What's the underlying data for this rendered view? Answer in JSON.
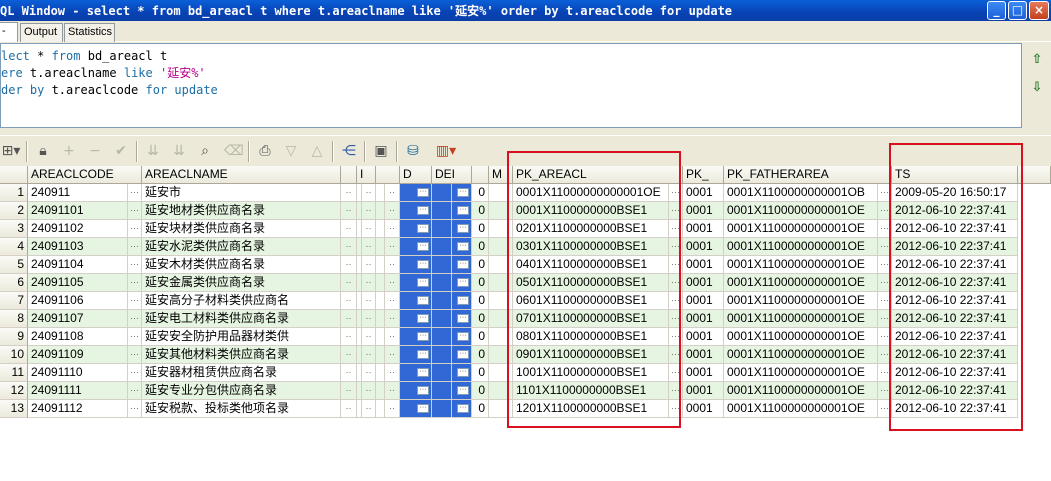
{
  "window": {
    "title": "SQL Window - select * from bd_areacl t where t.areaclname like '延安%' order by t.areaclcode for update",
    "title_visible": "QL Window - select * from bd_areacl t where t.areaclname like '延安%' order by t.areaclcode for update",
    "minimize": "_",
    "maximize": "□",
    "close": "×"
  },
  "tabs": [
    {
      "label": "-"
    },
    {
      "label": "Output"
    },
    {
      "label": "Statistics"
    }
  ],
  "editor": {
    "line1_kw1": "lect",
    "line1_kw2": "from",
    "line1_rest": " * ",
    "line1_table": " bd_areacl t",
    "line2_kw": "ere",
    "line2_mid": " t.areaclname ",
    "line2_kw2": "like",
    "line2_str": "'延安%'",
    "line3_kw": "der by",
    "line3_mid": " t.areaclcode ",
    "line3_kw2": "for update"
  },
  "grid": {
    "columns": [
      "",
      "AREACLCODE",
      "AREACLNAME",
      "",
      "I",
      "",
      "D",
      "DEI",
      "",
      "M",
      "PK_AREACL",
      "PK_",
      "PK_FATHERAREA",
      "TS"
    ],
    "rows": [
      {
        "n": "1",
        "code": "240911",
        "name": "延安市",
        "m": "0",
        "pk": "0001X11000000000001OE",
        "pkf": "0001X1100000000001OB",
        "ts": "2009-05-20 16:50:17",
        "pk_short": "0001"
      },
      {
        "n": "2",
        "code": "24091101",
        "name": "延安地材类供应商名录",
        "m": "0",
        "pk": "0001X1100000000BSE1",
        "pkf": "0001X1100000000001OE",
        "ts": "2012-06-10 22:37:41",
        "pk_short": "0001"
      },
      {
        "n": "3",
        "code": "24091102",
        "name": "延安块材类供应商名录",
        "m": "0",
        "pk": "0201X1100000000BSE1",
        "pkf": "0001X1100000000001OE",
        "ts": "2012-06-10 22:37:41",
        "pk_short": "0001"
      },
      {
        "n": "4",
        "code": "24091103",
        "name": "延安水泥类供应商名录",
        "m": "0",
        "pk": "0301X1100000000BSE1",
        "pkf": "0001X1100000000001OE",
        "ts": "2012-06-10 22:37:41",
        "pk_short": "0001"
      },
      {
        "n": "5",
        "code": "24091104",
        "name": "延安木材类供应商名录",
        "m": "0",
        "pk": "0401X1100000000BSE1",
        "pkf": "0001X1100000000001OE",
        "ts": "2012-06-10 22:37:41",
        "pk_short": "0001"
      },
      {
        "n": "6",
        "code": "24091105",
        "name": "延安金属类供应商名录",
        "m": "0",
        "pk": "0501X1100000000BSE1",
        "pkf": "0001X1100000000001OE",
        "ts": "2012-06-10 22:37:41",
        "pk_short": "0001"
      },
      {
        "n": "7",
        "code": "24091106",
        "name": "延安高分子材料类供应商名",
        "m": "0",
        "pk": "0601X1100000000BSE1",
        "pkf": "0001X1100000000001OE",
        "ts": "2012-06-10 22:37:41",
        "pk_short": "0001"
      },
      {
        "n": "8",
        "code": "24091107",
        "name": "延安电工材料类供应商名录",
        "m": "0",
        "pk": "0701X1100000000BSE1",
        "pkf": "0001X1100000000001OE",
        "ts": "2012-06-10 22:37:41",
        "pk_short": "0001"
      },
      {
        "n": "9",
        "code": "24091108",
        "name": "延安安全防护用品器材类供",
        "m": "0",
        "pk": "0801X1100000000BSE1",
        "pkf": "0001X1100000000001OE",
        "ts": "2012-06-10 22:37:41",
        "pk_short": "0001"
      },
      {
        "n": "10",
        "code": "24091109",
        "name": "延安其他材料类供应商名录",
        "m": "0",
        "pk": "0901X1100000000BSE1",
        "pkf": "0001X1100000000001OE",
        "ts": "2012-06-10 22:37:41",
        "pk_short": "0001"
      },
      {
        "n": "11",
        "code": "24091110",
        "name": "延安器材租赁供应商名录",
        "m": "0",
        "pk": "1001X1100000000BSE1",
        "pkf": "0001X1100000000001OE",
        "ts": "2012-06-10 22:37:41",
        "pk_short": "0001"
      },
      {
        "n": "12",
        "code": "24091111",
        "name": "延安专业分包供应商名录",
        "m": "0",
        "pk": "1101X1100000000BSE1",
        "pkf": "0001X1100000000001OE",
        "ts": "2012-06-10 22:37:41",
        "pk_short": "0001"
      },
      {
        "n": "13",
        "code": "24091112",
        "name": "延安税款、投标类他项名录",
        "m": "0",
        "pk": "1201X1100000000BSE1",
        "pkf": "0001X1100000000001OE",
        "ts": "2012-06-10 22:37:41",
        "pk_short": "0001"
      }
    ]
  },
  "toolbar": {
    "icons": [
      "grid-icon",
      "lock-icon",
      "plus-icon",
      "minus-icon",
      "check-icon",
      "down-double-icon",
      "down-double-icon",
      "binoculars-icon",
      "eraser-icon",
      "print-icon",
      "down-arrow-icon",
      "up-arrow-icon",
      "tree-icon",
      "save-icon",
      "db-icon",
      "chart-icon"
    ]
  },
  "colors": {
    "highlight_border": "#d9101f",
    "selected_column": "#3168d5",
    "alt_row": "#e6f5e1"
  }
}
